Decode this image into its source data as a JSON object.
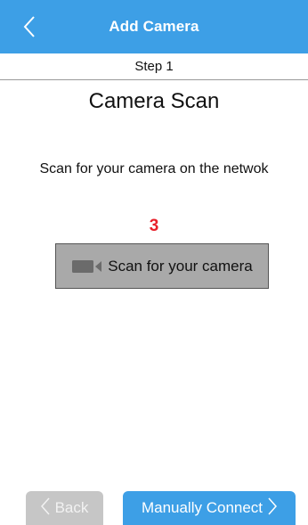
{
  "header": {
    "title": "Add Camera",
    "back_icon": "chevron-left-icon"
  },
  "step": {
    "label": "Step 1"
  },
  "main": {
    "title": "Camera Scan",
    "instruction": "Scan for your camera on the netwok",
    "step_number": "3",
    "scan_button": {
      "label": "Scan for your camera",
      "icon": "video-camera-icon"
    }
  },
  "footer": {
    "back_label": "Back",
    "back_icon": "chevron-left-icon",
    "connect_label": "Manually Connect",
    "connect_icon": "chevron-right-icon"
  },
  "colors": {
    "accent": "#3d9fe6",
    "step_number": "#e8202a",
    "scan_button_bg": "#a9a9a9",
    "disabled_button": "#c6c6c6"
  }
}
